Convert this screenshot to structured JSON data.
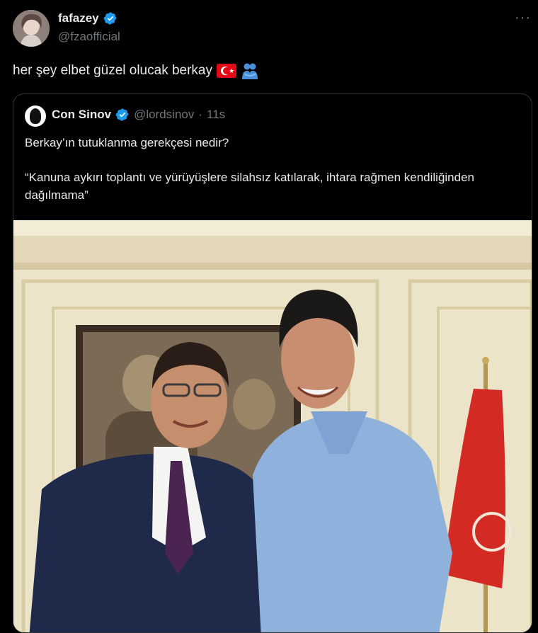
{
  "tweet": {
    "display_name": "fafazey",
    "handle": "@fzaofficial",
    "more": "···",
    "text": "her şey elbet güzel olucak berkay",
    "emojis": [
      "turkey-flag-icon",
      "people-hugging-icon"
    ]
  },
  "quoted": {
    "display_name": "Con Sinov",
    "handle": "@lordsinov",
    "separator": "·",
    "time": "11s",
    "line1": "Berkay’ın tutuklanma gerekçesi nedir?",
    "line2": "“Kanuna aykırı toplantı ve yürüyüşlere silahsız katılarak, ihtara rağmen kendiliğinden dağılmama”"
  },
  "colors": {
    "background": "#000000",
    "text": "#e7e9ea",
    "muted": "#71767b",
    "verified": "#1d9bf0",
    "border": "#2f3336"
  }
}
